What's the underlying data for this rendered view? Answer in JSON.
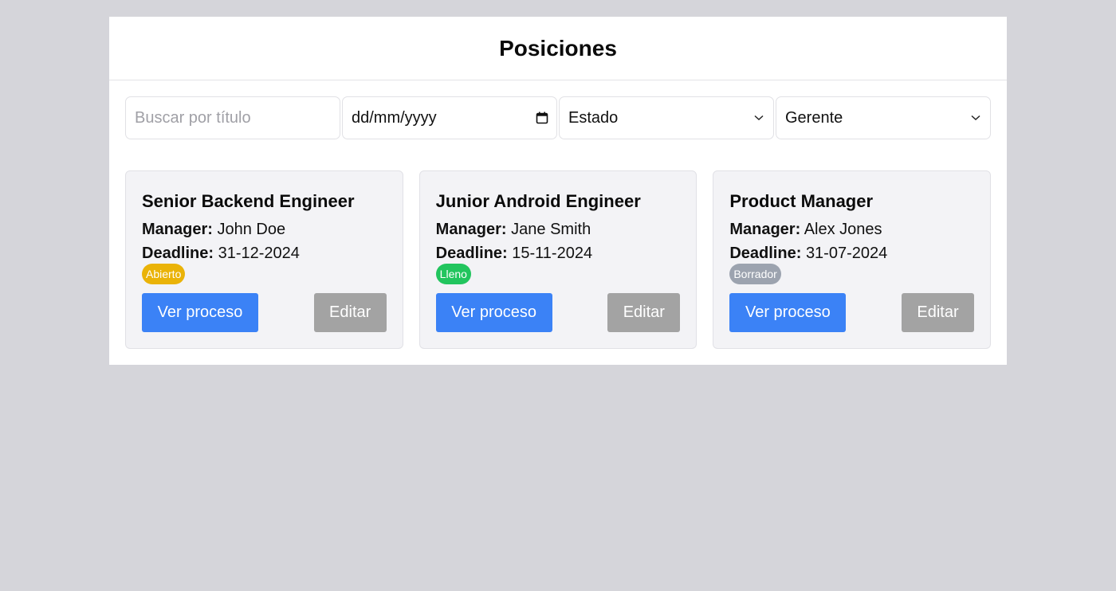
{
  "page": {
    "title": "Posiciones"
  },
  "filters": {
    "search_placeholder": "Buscar por título",
    "date_value": "dd/mm/yyyy",
    "date_icon": "calendar-icon",
    "status_select": "Estado",
    "manager_select": "Gerente",
    "select_icon": "chevron-down-icon"
  },
  "labels": {
    "manager": "Manager:",
    "deadline": "Deadline:",
    "view_button": "Ver proceso",
    "edit_button": "Editar"
  },
  "colors": {
    "primary_button": "#3b82f6",
    "secondary_button": "#a3a3a3",
    "badge_open": "#eab308",
    "badge_filled": "#22c55e",
    "badge_draft": "#9ca3af"
  },
  "positions": [
    {
      "title": "Senior Backend Engineer",
      "manager": "John Doe",
      "deadline": "31-12-2024",
      "status": "Abierto",
      "status_color": "#eab308"
    },
    {
      "title": "Junior Android Engineer",
      "manager": "Jane Smith",
      "deadline": "15-11-2024",
      "status": "Lleno",
      "status_color": "#22c55e"
    },
    {
      "title": "Product Manager",
      "manager": "Alex Jones",
      "deadline": "31-07-2024",
      "status": "Borrador",
      "status_color": "#9ca3af"
    }
  ]
}
